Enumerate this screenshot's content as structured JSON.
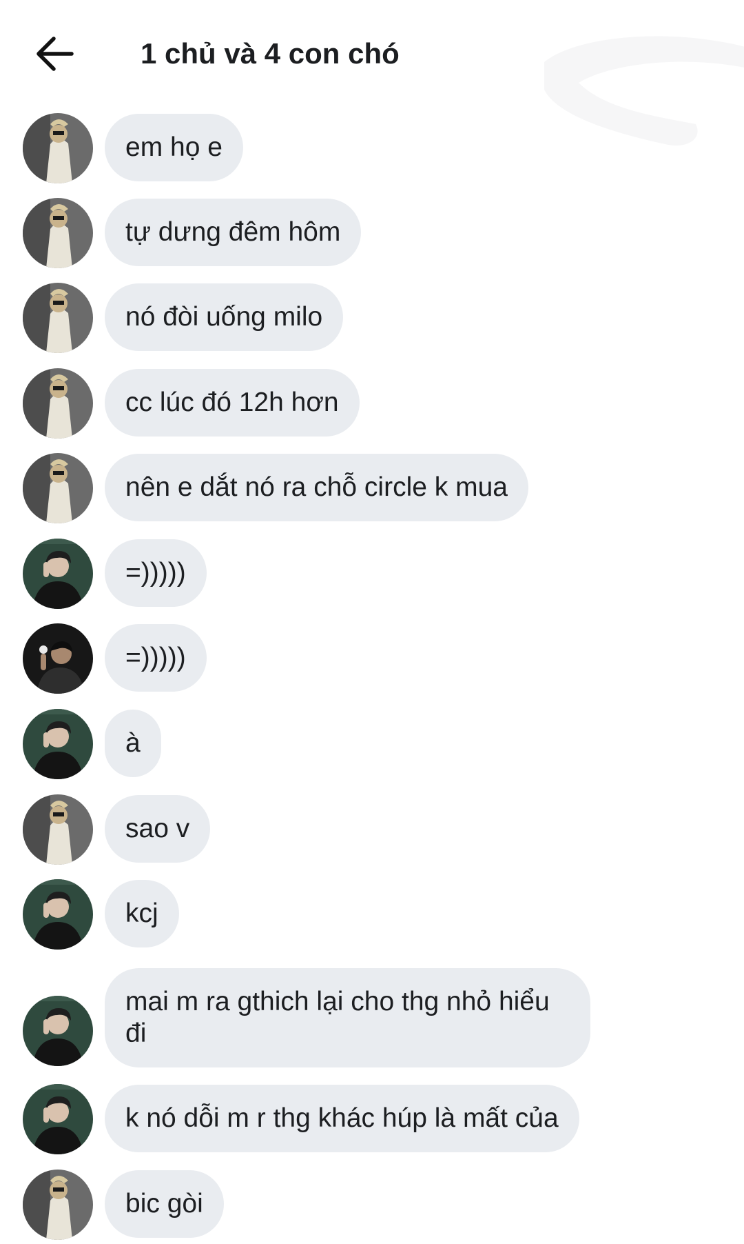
{
  "header": {
    "title": "1 chủ và 4 con chó",
    "back_icon": "arrow-left-icon"
  },
  "colors": {
    "bubble_bg": "#e9ecf0",
    "text": "#1c1e21",
    "background": "#ffffff"
  },
  "messages": [
    {
      "sender": "user-a",
      "text": "em họ e"
    },
    {
      "sender": "user-a",
      "text": "tự dưng đêm hôm"
    },
    {
      "sender": "user-a",
      "text": "nó đòi uống milo"
    },
    {
      "sender": "user-a",
      "text": "cc lúc đó 12h hơn"
    },
    {
      "sender": "user-a",
      "text": "nên e dắt nó ra chỗ circle k mua"
    },
    {
      "sender": "user-b",
      "text": "=)))))"
    },
    {
      "sender": "user-c",
      "text": "=)))))"
    },
    {
      "sender": "user-b",
      "text": "à"
    },
    {
      "sender": "user-a",
      "text": "sao v"
    },
    {
      "sender": "user-b",
      "text": "kcj"
    },
    {
      "sender": "user-b",
      "text": "mai m ra gthich lại cho thg nhỏ hiểu đi"
    },
    {
      "sender": "user-b",
      "text": "k nó dỗi m r thg khác húp là mất của"
    },
    {
      "sender": "user-a",
      "text": "bic gòi"
    }
  ]
}
